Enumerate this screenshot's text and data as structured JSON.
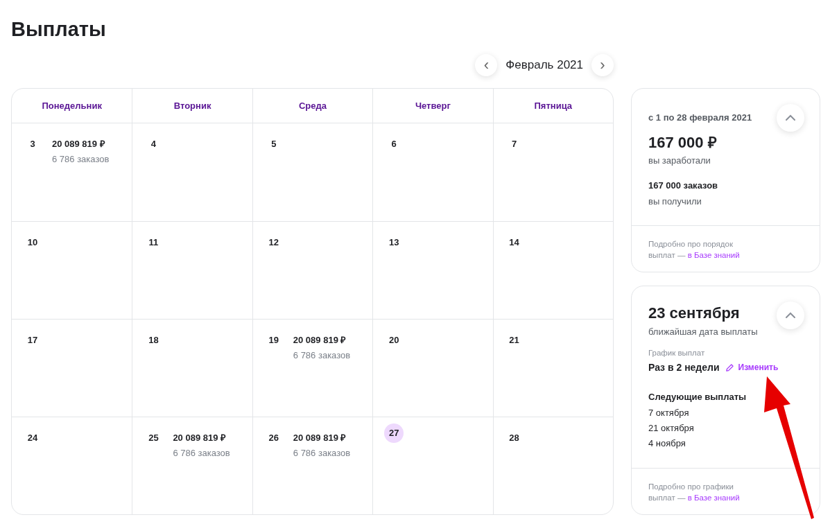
{
  "page_title": "Выплаты",
  "month_nav": {
    "prev": "‹",
    "label": "Февраль 2021",
    "next": "›"
  },
  "calendar": {
    "columns": [
      "Понедельник",
      "Вторник",
      "Среда",
      "Четверг",
      "Пятница"
    ],
    "weeks": [
      [
        {
          "day": "3",
          "amount": "20 089 819 ₽",
          "orders": "6 786 заказов",
          "today": false
        },
        {
          "day": "4",
          "today": false
        },
        {
          "day": "5",
          "today": false
        },
        {
          "day": "6",
          "today": false
        },
        {
          "day": "7",
          "today": false
        }
      ],
      [
        {
          "day": "10",
          "today": false
        },
        {
          "day": "11",
          "today": false
        },
        {
          "day": "12",
          "today": false
        },
        {
          "day": "13",
          "today": false
        },
        {
          "day": "14",
          "today": false
        }
      ],
      [
        {
          "day": "17",
          "today": false
        },
        {
          "day": "18",
          "today": false
        },
        {
          "day": "19",
          "amount": "20 089 819 ₽",
          "orders": "6 786 заказов",
          "today": false
        },
        {
          "day": "20",
          "today": false
        },
        {
          "day": "21",
          "today": false
        }
      ],
      [
        {
          "day": "24",
          "today": false
        },
        {
          "day": "25",
          "amount": "20 089 819 ₽",
          "orders": "6 786 заказов",
          "today": false
        },
        {
          "day": "26",
          "amount": "20 089 819 ₽",
          "orders": "6 786 заказов",
          "today": false
        },
        {
          "day": "27",
          "today": true
        },
        {
          "day": "28",
          "today": false
        }
      ]
    ]
  },
  "summary_card": {
    "period": "с 1 по 28 февраля 2021",
    "expanded": true,
    "amount": "167 000 ₽",
    "amount_caption": "вы заработали",
    "orders": "167 000 заказов",
    "orders_caption": "вы получили",
    "footer_text": "Подробно про порядок выплат — ",
    "footer_link": "в Базе знаний"
  },
  "payout_card": {
    "date": "23 сентября",
    "expanded": true,
    "date_caption": "ближайшая дата выплаты",
    "schedule_label": "График выплат",
    "schedule_value": "Раз в 2 недели",
    "edit_link": "Изменить",
    "next_title": "Следующие выплаты",
    "next_dates": [
      "7 октября",
      "21 октября",
      "4 ноября"
    ],
    "footer_text": "Подробно про графики выплат — ",
    "footer_link": "в Базе знаний"
  }
}
